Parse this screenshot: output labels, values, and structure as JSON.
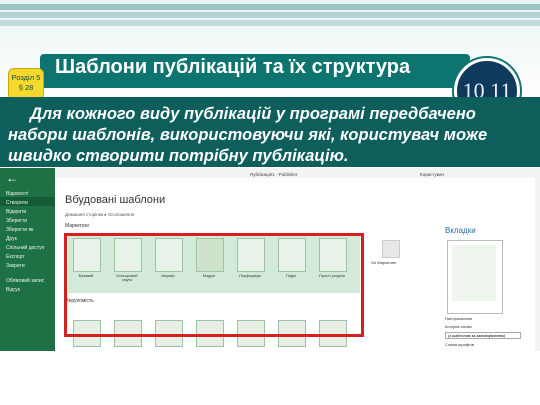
{
  "badge": {
    "line1": "Розділ 5",
    "line2": "§ 28"
  },
  "title": "Шаблони публікацій та їх структура",
  "logo": {
    "text": "10 11"
  },
  "description": "Для кожного виду публікацій у програмі передбачено набори шаблонів, використовуючи які, користувач може швидко створити потрібну публікацію.",
  "app": {
    "window_title": "Публікація1 - Publisher",
    "window_right": "Користувач",
    "back_icon": "arrow-left-icon",
    "sidebar": [
      "Відомості",
      "Створити",
      "Відкрити",
      "Зберегти",
      "Зберегти як",
      "Друк",
      "Спільний доступ",
      "Експорт",
      "Закрити",
      "Обліковий запис",
      "Відгук"
    ],
    "heading": "Вбудовані шаблони",
    "breadcrumb": "Домашня сторінка  ▸  Оголошення",
    "section1": "Маркетинг",
    "section2": "Нерухомість",
    "templates": [
      "Базовий",
      "Кольоровий смуга",
      "Маркер",
      "Модулі",
      "Перфорація",
      "Поділ",
      "Прості розділи"
    ],
    "more_label": "Усі Маркетинг",
    "right_panel": {
      "title": "Вкладки",
      "label_setup": "Настроювання",
      "label_scheme": "Колірна схема",
      "scheme_value": "(з шаблоном за замовчуванням)",
      "label_font": "Схема шрифтів"
    }
  },
  "colors": {
    "teal": "#0e7470",
    "highlight": "#d61f1f",
    "sidebar": "#1e7145"
  }
}
